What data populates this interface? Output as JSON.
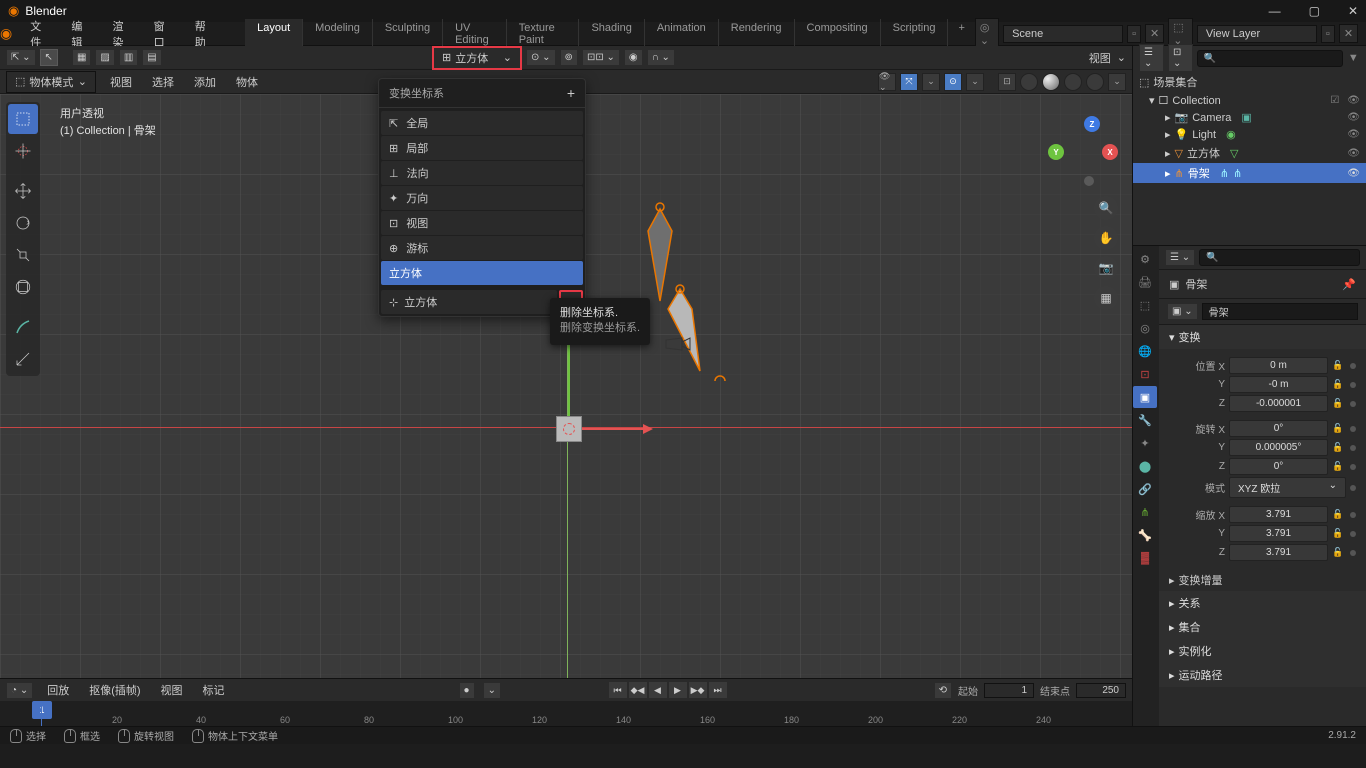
{
  "title_bar": {
    "app_name": "Blender"
  },
  "menu": {
    "file": "文件",
    "edit": "编辑",
    "render": "渲染",
    "window": "窗口",
    "help": "帮助"
  },
  "workspaces": {
    "tabs": [
      "Layout",
      "Modeling",
      "Sculpting",
      "UV Editing",
      "Texture Paint",
      "Shading",
      "Animation",
      "Rendering",
      "Compositing",
      "Scripting"
    ],
    "active": "Layout",
    "scene_icon_label": "Scene",
    "viewlayer_icon_label": "View Layer"
  },
  "viewport_header": {
    "transform_orientation": "立方体",
    "view_menu": "视图"
  },
  "viewport_subheader": {
    "mode": "物体模式",
    "view": "视图",
    "select": "选择",
    "add": "添加",
    "object": "物体"
  },
  "viewport_overlay": {
    "view_name": "用户透视",
    "collection_path": "(1) Collection | 骨架"
  },
  "transform_popup": {
    "title": "变换坐标系",
    "items": [
      {
        "icon": "⇱",
        "label": "全局"
      },
      {
        "icon": "⊞",
        "label": "局部"
      },
      {
        "icon": "⊥",
        "label": "法向"
      },
      {
        "icon": "✦",
        "label": "万向"
      },
      {
        "icon": "⊡",
        "label": "视图"
      },
      {
        "icon": "⊕",
        "label": "游标"
      }
    ],
    "highlighted": "立方体",
    "search_value": "立方体"
  },
  "tooltip": {
    "line1": "删除坐标系.",
    "line2": "删除变换坐标系."
  },
  "transform_bottom": {
    "label": "变换"
  },
  "timeline": {
    "playback": "回放",
    "keying": "抠像(插帧)",
    "view": "视图",
    "marker": "标记",
    "current_frame": "1",
    "start_label": "起始",
    "start": "1",
    "end_label": "结束点",
    "end": "250",
    "ticks": [
      "20",
      "40",
      "60",
      "80",
      "100",
      "120",
      "140",
      "160",
      "180",
      "200",
      "220",
      "240"
    ]
  },
  "outliner": {
    "scene_collection": "场景集合",
    "collection": "Collection",
    "items": [
      {
        "icon": "📷",
        "label": "Camera",
        "color": "#5ab5a5"
      },
      {
        "icon": "💡",
        "label": "Light",
        "color": "#e8b13a"
      },
      {
        "icon": "▽",
        "label": "立方体",
        "color": "#e8913a"
      },
      {
        "icon": "⋔",
        "label": "骨架",
        "color": "#e8913a",
        "selected": true
      }
    ],
    "search_placeholder": ""
  },
  "properties": {
    "search_placeholder": "",
    "object_name": "骨架",
    "data_name": "骨架",
    "transform_header": "变换",
    "position_label": "位置",
    "rotation_label": "旋转",
    "scale_label": "缩放",
    "mode_label": "模式",
    "axes": {
      "x": "X",
      "y": "Y",
      "z": "Z"
    },
    "position": {
      "x": "0 m",
      "y": "-0 m",
      "z": "-0.000001"
    },
    "rotation": {
      "x": "0°",
      "y": "0.000005°",
      "z": "0°"
    },
    "rotation_mode": "XYZ 欧拉",
    "scale": {
      "x": "3.791",
      "y": "3.791",
      "z": "3.791"
    },
    "delta_transform": "变换增量",
    "relations": "关系",
    "collections": "集合",
    "instancing": "实例化",
    "motion_paths": "运动路径"
  },
  "status": {
    "select": "选择",
    "box_select": "框选",
    "rotate_view": "旋转视图",
    "context_menu": "物体上下文菜单",
    "version": "2.91.2"
  },
  "nav_gizmo": {
    "x": "X",
    "y": "Y",
    "z": "Z"
  }
}
